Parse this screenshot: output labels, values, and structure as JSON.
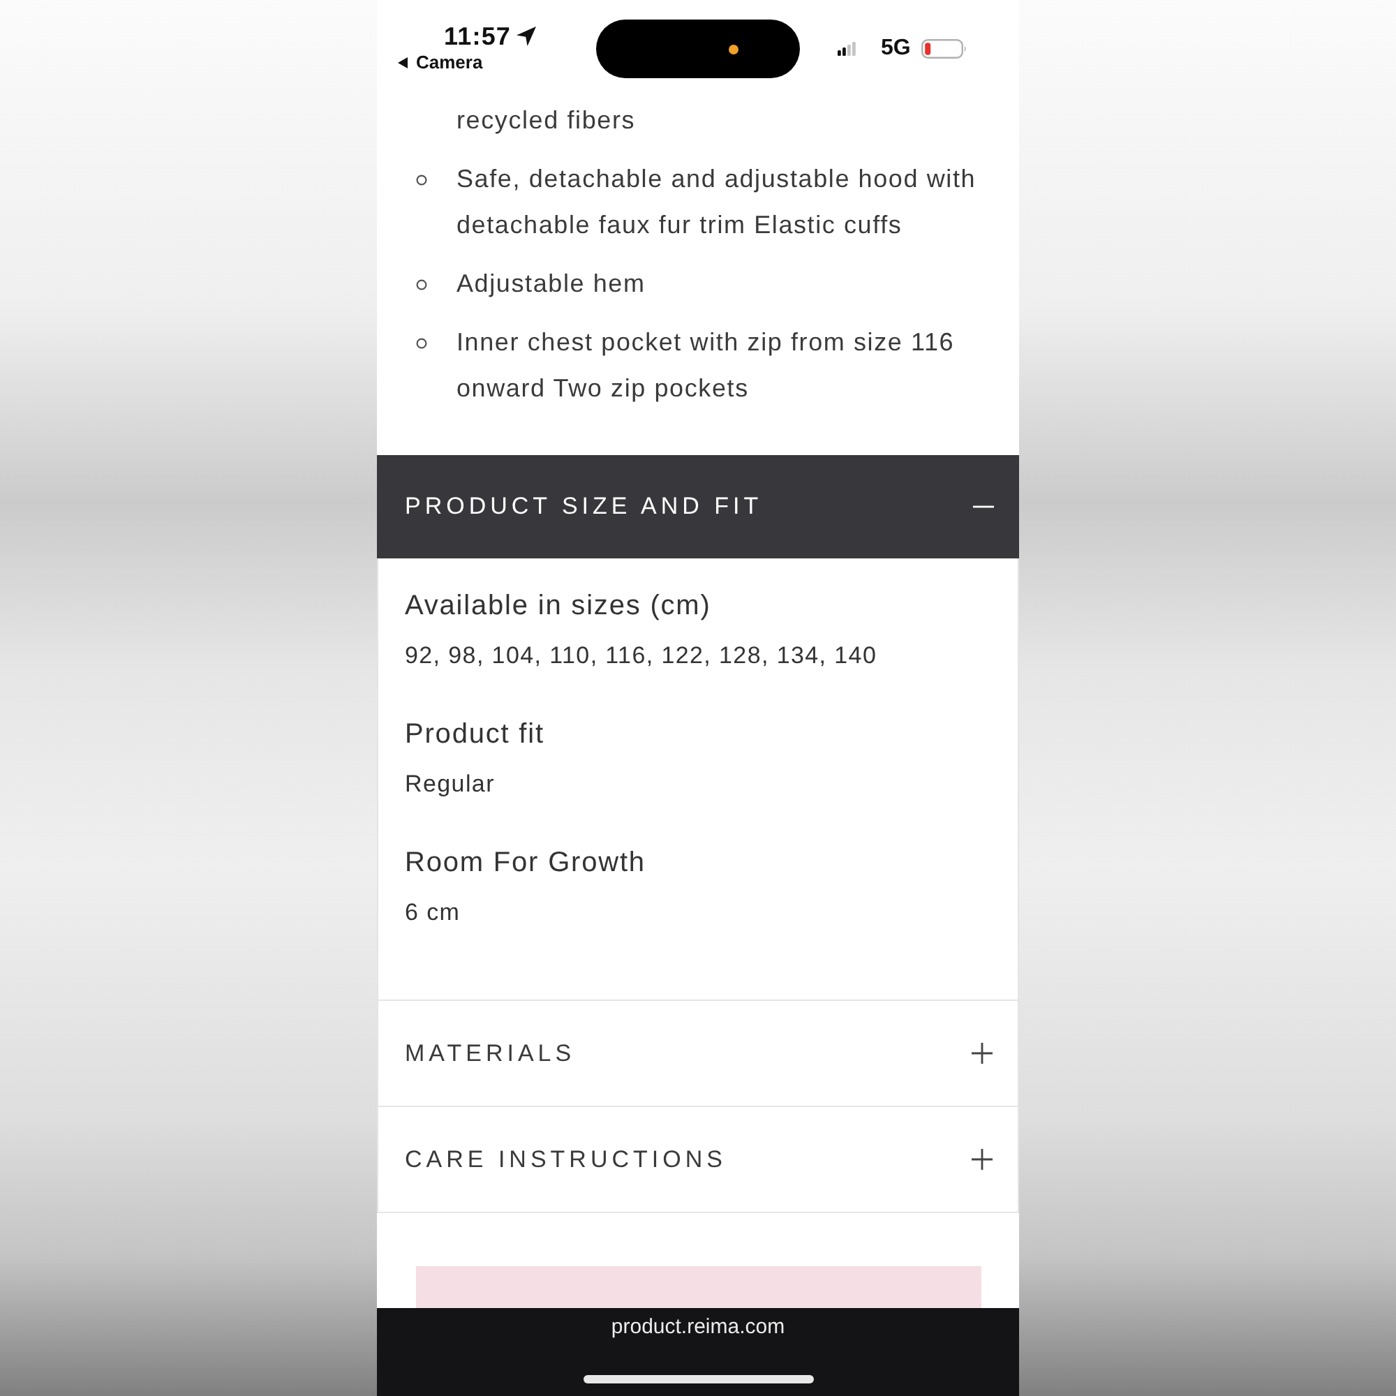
{
  "status_bar": {
    "time": "11:57",
    "back_label": "Camera",
    "network": "5G"
  },
  "features": [
    {
      "kind": "continuation",
      "text": "recycled fibers"
    },
    {
      "kind": "bullet",
      "text": "Safe, detachable and adjustable hood with detachable faux fur trim Elastic cuffs"
    },
    {
      "kind": "bullet",
      "text": "Adjustable hem"
    },
    {
      "kind": "bullet",
      "text": "Inner chest pocket with zip from size 116 onward Two zip pockets"
    }
  ],
  "accordion": [
    {
      "title": "PRODUCT SIZE AND FIT",
      "expanded": true,
      "details": [
        {
          "label": "Available in sizes (cm)",
          "value": "92, 98, 104, 110, 116, 122, 128, 134, 140"
        },
        {
          "label": "Product fit",
          "value": "Regular"
        },
        {
          "label": "Room For Growth",
          "value": "6 cm"
        }
      ]
    },
    {
      "title": "MATERIALS",
      "expanded": false
    },
    {
      "title": "CARE INSTRUCTIONS",
      "expanded": false
    }
  ],
  "browser_bar": {
    "url": "product.reima.com"
  }
}
